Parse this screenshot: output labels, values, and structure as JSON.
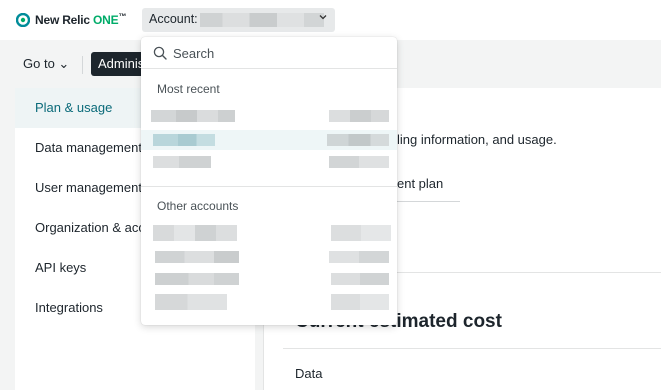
{
  "header": {
    "logo_text": "New Relic",
    "logo_one": "ONE",
    "logo_tm": "™",
    "account_label": "Account: ",
    "logo_icon": "new-relic-logo-icon",
    "chevron_icon": "chevron-down-icon"
  },
  "nav": {
    "goto_label": "Go to ⌄",
    "admin_label": "Administration"
  },
  "sidebar": {
    "items": [
      {
        "label": "Plan & usage",
        "active": true
      },
      {
        "label": "Data management",
        "active": false
      },
      {
        "label": "User management",
        "active": false
      },
      {
        "label": "Organization & access",
        "active": false
      },
      {
        "label": "API keys",
        "active": false
      },
      {
        "label": "Integrations",
        "active": false
      }
    ]
  },
  "main": {
    "description": "ling information, and usage.",
    "plan_link": "ent plan",
    "cost_title": "Current estimated cost",
    "data_label": "Data"
  },
  "dropdown": {
    "search_placeholder": "Search",
    "search_icon": "search-icon",
    "most_recent_heading": "Most recent",
    "other_accounts_heading": "Other accounts",
    "most_recent_count": 3,
    "other_accounts_count": 4
  },
  "colors": {
    "brand_green": "#00ac69",
    "active_text": "#0b6b7a",
    "active_bg": "#eef4f5",
    "hover_row_bg": "#eef6f7",
    "admin_pill_bg": "#1d252c"
  }
}
